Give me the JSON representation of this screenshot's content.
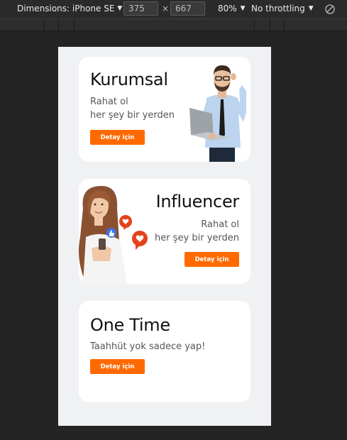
{
  "toolbar": {
    "dimensions_label": "Dimensions: iPhone SE",
    "width_value": "375",
    "height_value": "667",
    "times": "×",
    "zoom": "80%",
    "throttling": "No throttling"
  },
  "cards": [
    {
      "title": "Kurumsal",
      "subtitle_line1": "Rahat ol",
      "subtitle_line2": "her şey bir yerden",
      "button": "Detay için"
    },
    {
      "title": "Influencer",
      "subtitle_line1": "Rahat ol",
      "subtitle_line2": "her şey bir yerden",
      "button": "Detay için"
    },
    {
      "title": "One Time",
      "subtitle_line1": "Taahhüt yok sadece yap!",
      "button": "Detay için"
    }
  ],
  "colors": {
    "accent": "#ff6a00",
    "page_bg": "#f0f1f3",
    "card_bg": "#ffffff",
    "devtools_bg": "#242424"
  },
  "icons": [
    "caret-down-icon",
    "rotate-icon",
    "like-bubble-icon",
    "heart-bubble-icon"
  ]
}
